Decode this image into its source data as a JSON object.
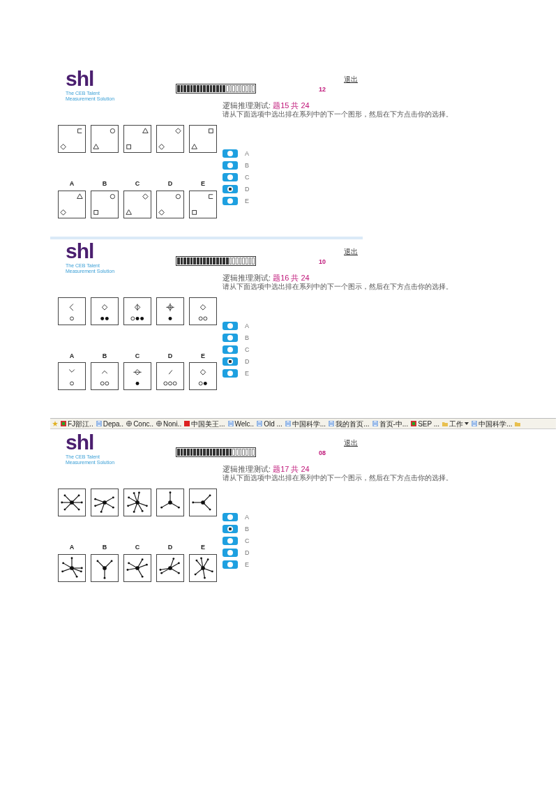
{
  "panels": [
    {
      "logo": {
        "wordmark": "shl",
        "tagline": [
          "The CEB Talent",
          "Measurement Solution"
        ]
      },
      "exit_link": "退出",
      "progress": {
        "level": 0.62
      },
      "timer": "12",
      "test_name": "逻辑推理测试:",
      "question_count": "题15 共 24",
      "instruction": "请从下面选项中选出排在系列中的下一个图形，然后在下方点击你的选择。",
      "answer_labels": [
        "A",
        "B",
        "C",
        "D",
        "E"
      ],
      "options": [
        {
          "label": "A",
          "selected": false
        },
        {
          "label": "B",
          "selected": false
        },
        {
          "label": "C",
          "selected": false
        },
        {
          "label": "D",
          "selected": true
        },
        {
          "label": "E",
          "selected": false
        }
      ]
    },
    {
      "logo": {
        "wordmark": "shl",
        "tagline": [
          "The CEB Talent",
          "Measurement Solution"
        ]
      },
      "exit_link": "退出",
      "progress": {
        "level": 0.67
      },
      "timer": "10",
      "test_name": "逻辑推理测试:",
      "question_count": "题16 共 24",
      "instruction": "请从下面选项中选出排在系列中的下一个图示，然后在下方点击你的选择。",
      "answer_labels": [
        "A",
        "B",
        "C",
        "D",
        "E"
      ],
      "options": [
        {
          "label": "A",
          "selected": false
        },
        {
          "label": "B",
          "selected": false
        },
        {
          "label": "C",
          "selected": false
        },
        {
          "label": "D",
          "selected": true
        },
        {
          "label": "E",
          "selected": false
        }
      ]
    },
    {
      "bookmarks": [
        {
          "kind": "star"
        },
        {
          "kind": "site",
          "label": "FJ部江.."
        },
        {
          "kind": "page",
          "label": "Depa.."
        },
        {
          "kind": "globe",
          "label": "Conc.."
        },
        {
          "kind": "globe",
          "label": "Noni.."
        },
        {
          "kind": "red",
          "label": "中国美王..."
        },
        {
          "kind": "page",
          "label": "Welc.."
        },
        {
          "kind": "page",
          "label": "Old ..."
        },
        {
          "kind": "page",
          "label": "中国科学..."
        },
        {
          "kind": "page",
          "label": "我的首页..."
        },
        {
          "kind": "page",
          "label": "首页-中..."
        },
        {
          "kind": "site",
          "label": "SEP ..."
        },
        {
          "kind": "folder",
          "label": "工作",
          "dropdown": true
        },
        {
          "kind": "page",
          "label": "中国科学..."
        },
        {
          "kind": "folder"
        }
      ],
      "logo": {
        "wordmark": "shl",
        "tagline": [
          "The CEB Talent",
          "Measurement Solution"
        ]
      },
      "exit_link": "退出",
      "progress": {
        "level": 0.71
      },
      "timer": "08",
      "test_name": "逻辑推理测试:",
      "question_count": "题17 共 24",
      "instruction": "请从下面选项中选出排在系列中的下一个图示，然后在下方点击你的选择。",
      "answer_labels": [
        "A",
        "B",
        "C",
        "D",
        "E"
      ],
      "options": [
        {
          "label": "A",
          "selected": false
        },
        {
          "label": "B",
          "selected": true
        },
        {
          "label": "C",
          "selected": false
        },
        {
          "label": "D",
          "selected": false
        },
        {
          "label": "E",
          "selected": false
        }
      ]
    }
  ]
}
